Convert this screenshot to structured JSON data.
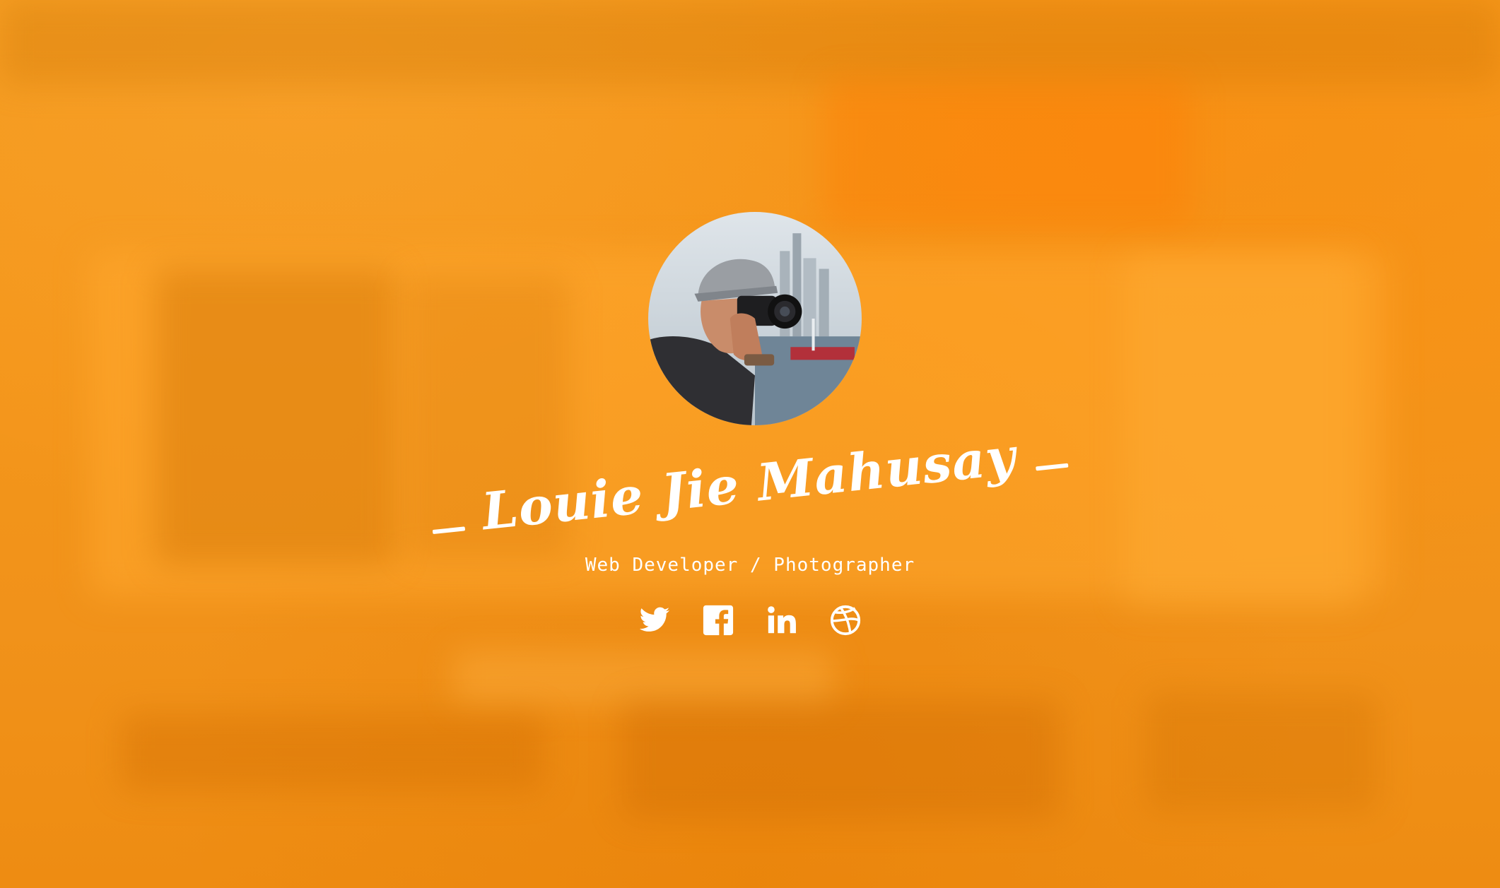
{
  "profile": {
    "name": "Louie Jie Mahusay",
    "subtitle": "Web Developer / Photographer",
    "avatar_alt": "Profile photo of a person holding a camera"
  },
  "social": [
    {
      "icon": "twitter-icon"
    },
    {
      "icon": "facebook-icon"
    },
    {
      "icon": "linkedin-icon"
    },
    {
      "icon": "dribbble-icon"
    }
  ],
  "colors": {
    "background": "#f08c0e",
    "text": "#ffffff"
  }
}
